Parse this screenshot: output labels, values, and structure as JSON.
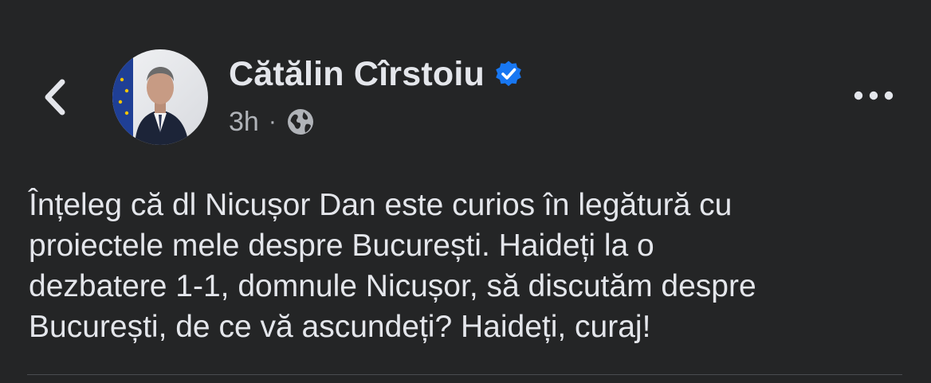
{
  "post": {
    "author_name": "Cătălin Cîrstoiu",
    "verified": true,
    "timestamp": "3h",
    "separator": "·",
    "audience_icon": "globe-icon",
    "text": "Înțeleg că dl Nicușor Dan este curios în legătură cu\nproiectele mele despre București. Haideți la o\ndezbatere 1-1, domnule Nicușor, să discutăm despre\nBucurești, de ce vă ascundeți? Haideți, curaj!"
  },
  "icons": {
    "back": "chevron-left-icon",
    "more": "more-horizontal-icon",
    "verified": "verified-badge-icon"
  },
  "colors": {
    "background": "#242526",
    "primary_text": "#e4e6eb",
    "secondary_text": "#b0b3b8",
    "verified_blue": "#1877f2",
    "divider": "#4a4c50"
  }
}
